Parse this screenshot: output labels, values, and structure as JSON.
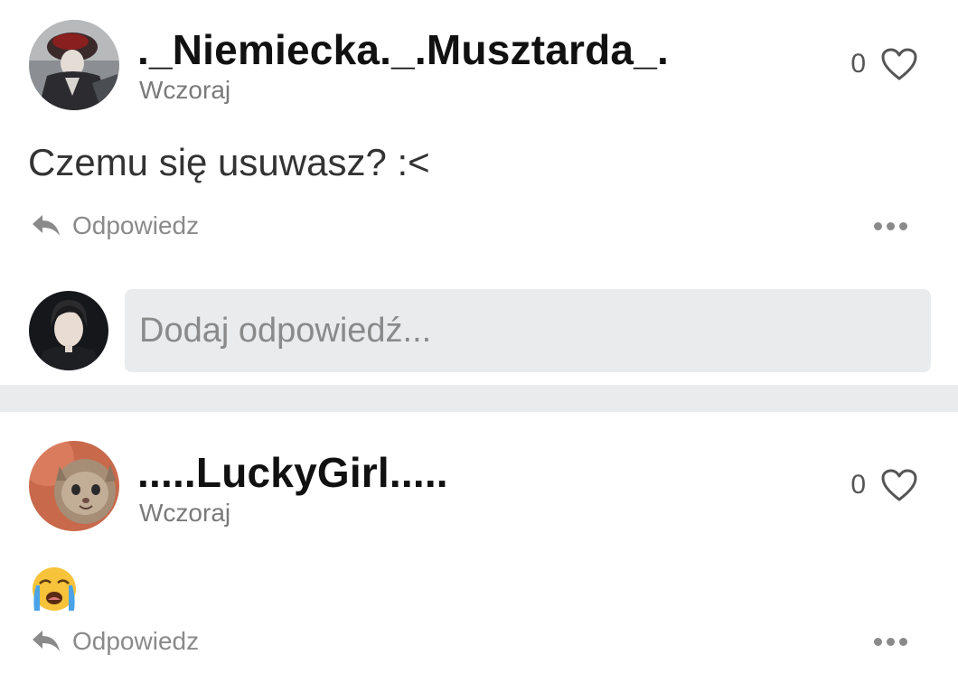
{
  "comments": [
    {
      "username": "._Niemiecka._.Musztarda_.",
      "timestamp": "Wczoraj",
      "likes": "0",
      "text": "Czemu się usuwasz? :<",
      "reply_label": "Odpowiedz",
      "avatar_icon": "avatar-dark-figure"
    },
    {
      "username": ".....LuckyGirl.....",
      "timestamp": "Wczoraj",
      "likes": "0",
      "text": "😭",
      "reply_label": "Odpowiedz",
      "avatar_icon": "avatar-cat"
    }
  ],
  "reply_box": {
    "placeholder": "Dodaj odpowiedź..."
  },
  "colors": {
    "separator": "#e9ebec",
    "muted_text": "#8a8a8a",
    "input_bg": "#e9ebec"
  }
}
